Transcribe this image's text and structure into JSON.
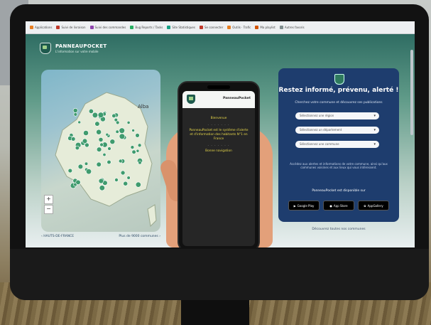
{
  "bookmarks": [
    {
      "label": "Applications",
      "color": "#e67e22"
    },
    {
      "label": "Suivi de livraison",
      "color": "#c0392b"
    },
    {
      "label": "Suivi des commandes",
      "color": "#8e44ad"
    },
    {
      "label": "Bug Reports / Tasks",
      "color": "#27ae60"
    },
    {
      "label": "Site Statistiques",
      "color": "#16a085"
    },
    {
      "label": "Se connecter",
      "color": "#c0392b"
    },
    {
      "label": "Outils · Trafic",
      "color": "#e67e22"
    },
    {
      "label": "Ma playlist",
      "color": "#d35400"
    },
    {
      "label": "Autres favoris",
      "color": "#7f8c8d"
    }
  ],
  "site": {
    "brand": "PANNEAUPOCKET",
    "tagline": "L'information sur votre mobile"
  },
  "map": {
    "label_city": "Alba",
    "zoom_in": "+",
    "zoom_out": "−",
    "caption_left": "‹ HAUTS-DE-FRANCE",
    "caption_right": "Plus de 9000 communes ›"
  },
  "phone": {
    "title": "PanneauPocket",
    "menu": [
      "Bienvenue",
      "PanneauPocket est le système d'alerte et d'information des habitants N°1 en France",
      "Bonne navigation"
    ],
    "separator": "- - - - - - -"
  },
  "panel": {
    "title": "Restez informé, prévenu, alerté !",
    "intro": "Cherchez votre commune et découvrez ses publications",
    "select_region": "Sélectionnez une région",
    "select_department": "Sélectionnez un département",
    "select_commune": "Sélectionnez une commune",
    "note": "Accédez aux alertes et informations de votre commune, ainsi qu'aux communes voisines et aux lieux qui vous intéressent.",
    "download_label": "PanneauPocket est disponible sur",
    "stores": [
      "Google Play",
      "App Store",
      "AppGallery"
    ],
    "below_text": "Découvrez toutes nos communes"
  }
}
